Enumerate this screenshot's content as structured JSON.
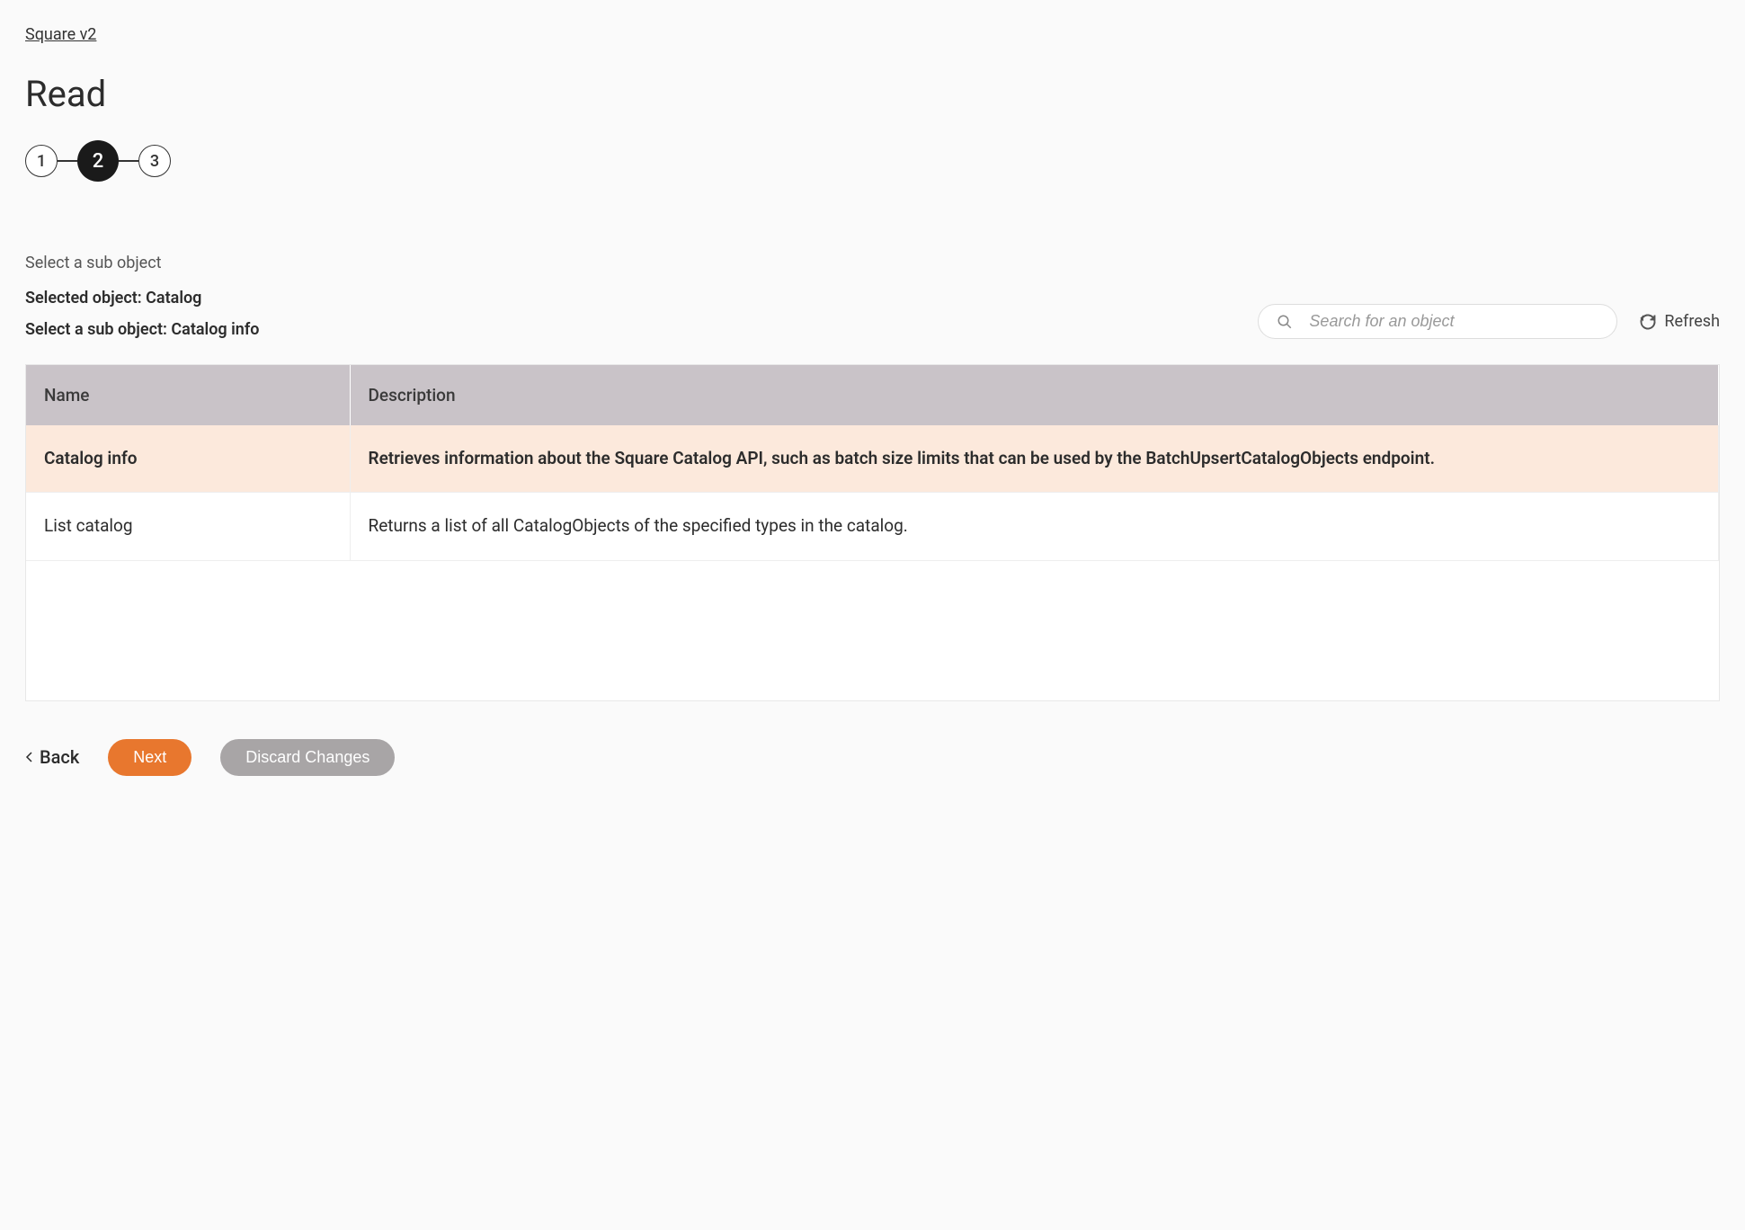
{
  "breadcrumb": "Square v2",
  "page_title": "Read",
  "stepper": {
    "steps": [
      "1",
      "2",
      "3"
    ],
    "active_index": 1
  },
  "sub_label": "Select a sub object",
  "selected_object_label": "Selected object: Catalog",
  "select_sub_object_label": "Select a sub object: Catalog info",
  "search": {
    "placeholder": "Search for an object"
  },
  "refresh_label": "Refresh",
  "table": {
    "headers": {
      "name": "Name",
      "description": "Description"
    },
    "rows": [
      {
        "name": "Catalog info",
        "description": "Retrieves information about the Square Catalog API, such as batch size limits that can be used by the BatchUpsertCatalogObjects endpoint.",
        "selected": true
      },
      {
        "name": "List catalog",
        "description": "Returns a list of all CatalogObjects of the specified types in the catalog.",
        "selected": false
      }
    ]
  },
  "buttons": {
    "back": "Back",
    "next": "Next",
    "discard": "Discard Changes"
  }
}
